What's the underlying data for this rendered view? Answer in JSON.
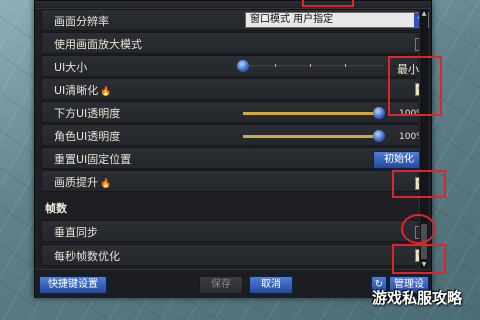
{
  "settings": {
    "resolution": {
      "label": "画面分辨率",
      "value": "窗口模式 用户指定"
    },
    "magnify": {
      "label": "使用画面放大模式"
    },
    "ui_size": {
      "label": "UI大小",
      "value": "最小"
    },
    "ui_sharpen": {
      "label": "UI清晰化"
    },
    "bottom_ui_opacity": {
      "label": "下方UI透明度",
      "value": "100%",
      "level": 1.0
    },
    "role_ui_opacity": {
      "label": "角色UI透明度",
      "value": "100%",
      "level": 1.0
    },
    "reset_ui": {
      "label": "重置UI固定位置",
      "button": "初始化"
    },
    "quality_boost": {
      "label": "画质提升"
    }
  },
  "framerate_section": {
    "title": "帧数",
    "vsync": {
      "label": "垂直同步"
    },
    "fps_opt": {
      "label": "每秒帧数优化"
    }
  },
  "footer": {
    "hotkeys": "快捷键设置",
    "save": "保存",
    "cancel": "取消",
    "manage": "管理设置"
  },
  "watermark": "游戏私服攻略",
  "colors": {
    "accent": "#2d53b8",
    "highlight": "#e0242a",
    "slider": "#d1a940"
  }
}
